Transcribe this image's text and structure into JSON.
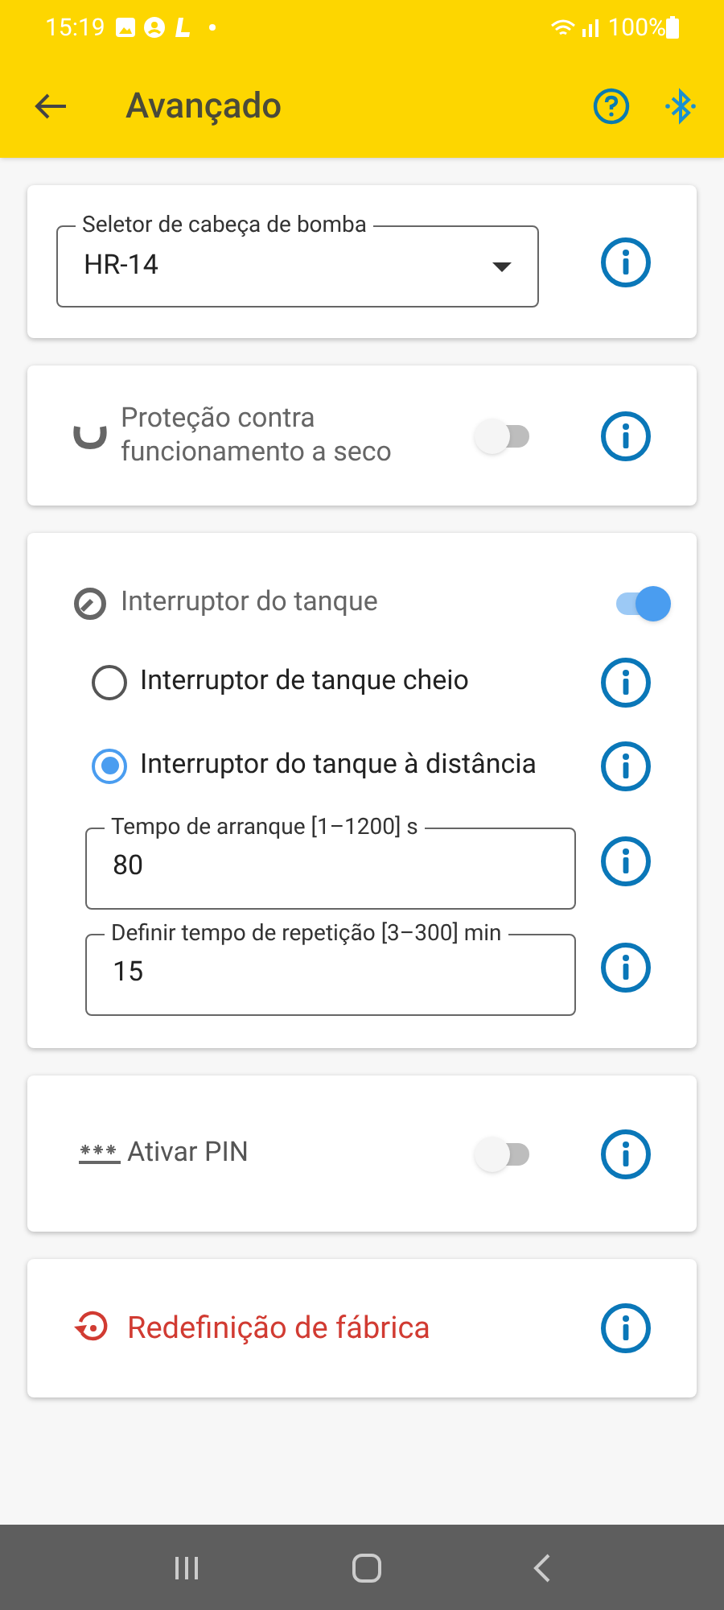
{
  "status_bar": {
    "time": "15:19",
    "battery": "100%"
  },
  "header": {
    "title": "Avançado"
  },
  "pump_head": {
    "label": "Seletor de cabeça de bomba",
    "value": "HR-14"
  },
  "dry_run": {
    "label": "Proteção contra funcionamento a seco",
    "on": false
  },
  "tank_switch": {
    "label": "Interruptor do tanque",
    "on": true,
    "options": [
      {
        "label": "Interruptor de tanque cheio",
        "selected": false
      },
      {
        "label": "Interruptor do tanque à distância",
        "selected": true
      }
    ],
    "fields": [
      {
        "label": "Tempo de arranque [1–1200] s",
        "value": "80"
      },
      {
        "label": "Definir tempo de repetição [3–300] min",
        "value": "15"
      }
    ]
  },
  "pin": {
    "label": "Ativar PIN",
    "on": false
  },
  "factory_reset": {
    "label": "Redefinição de fábrica"
  }
}
